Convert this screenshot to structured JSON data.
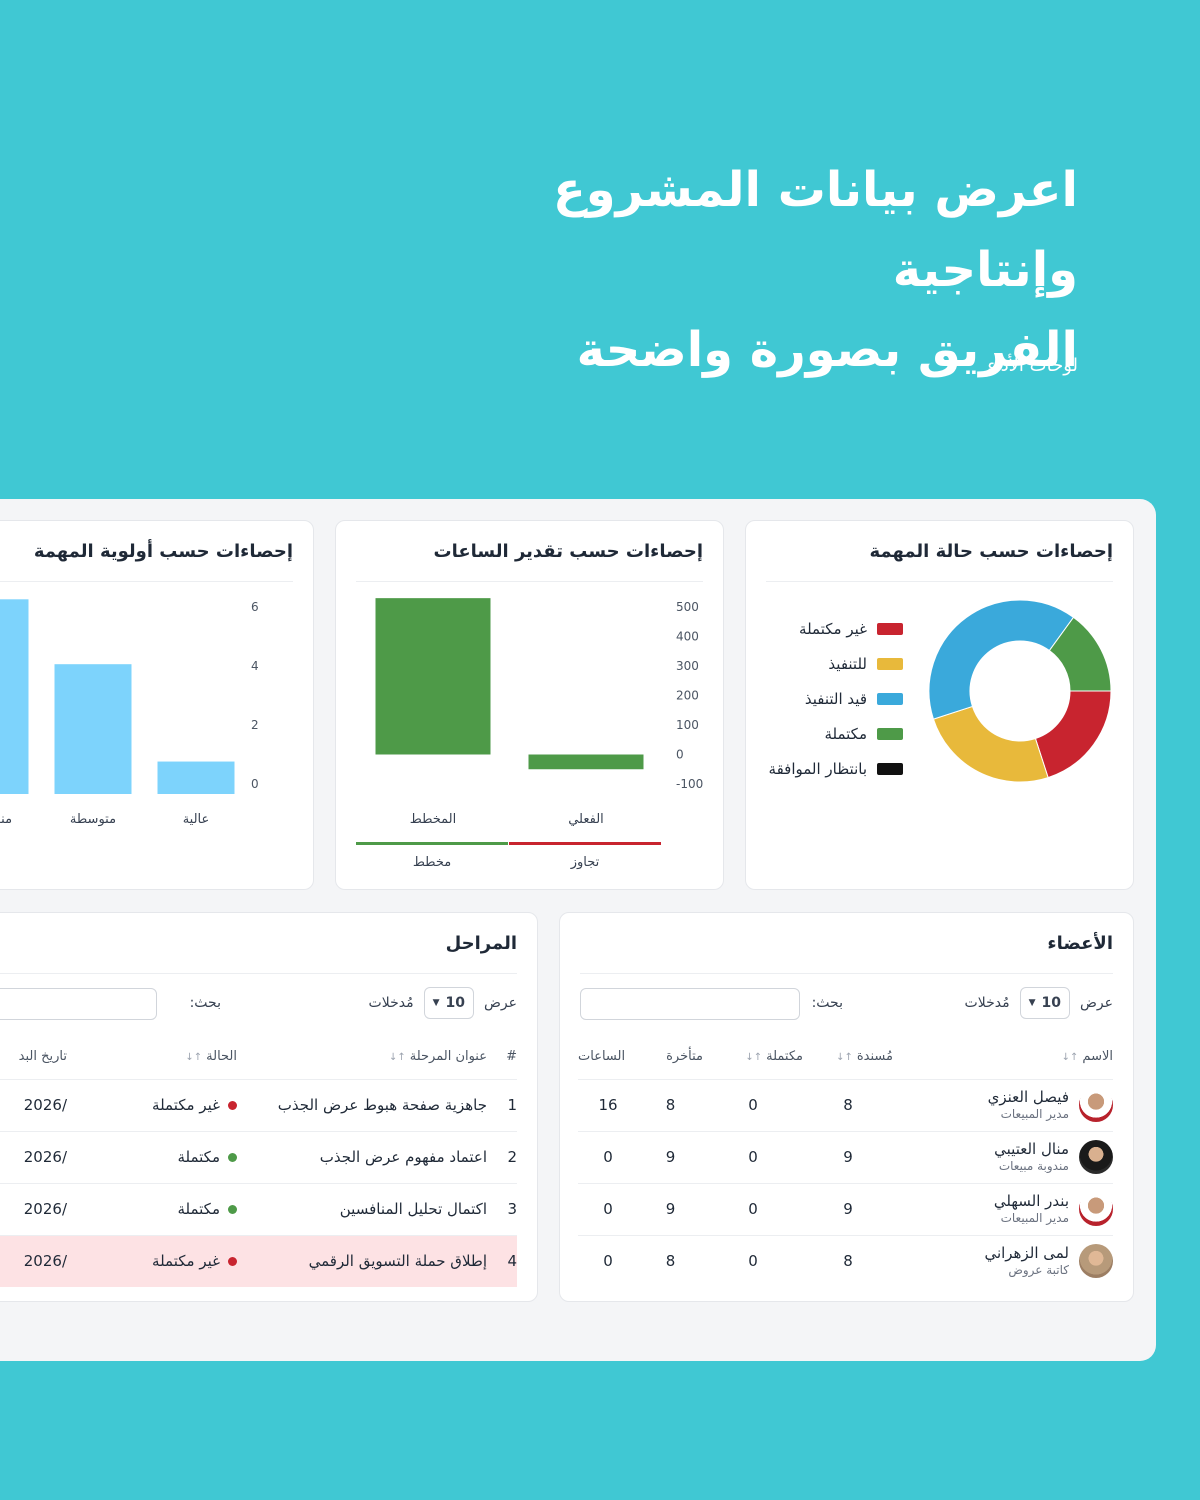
{
  "hero": {
    "title_line1": "اعرض بيانات المشروع وإنتاجية",
    "title_line2": "الفريق بصورة واضحة",
    "subtitle": "لوحات الأداء"
  },
  "status_card": {
    "title": "إحصاءات حسب حالة المهمة",
    "legend": [
      {
        "label": "غير مكتملة",
        "color": "#c8242f"
      },
      {
        "label": "للتنفيذ",
        "color": "#e8b93b"
      },
      {
        "label": "قيد التنفيذ",
        "color": "#3aa9db"
      },
      {
        "label": "مكتملة",
        "color": "#4e9a48"
      },
      {
        "label": "بانتظار الموافقة",
        "color": "#111111"
      }
    ]
  },
  "hours_card": {
    "title": "إحصاءات حسب تقدير الساعات",
    "legend": [
      {
        "label": "مخطط",
        "color": "#4e9a48"
      },
      {
        "label": "تجاوز",
        "color": "#c8242f"
      }
    ]
  },
  "priority_card": {
    "title": "إحصاءات حسب أولوية المهمة"
  },
  "chart_data": [
    {
      "type": "pie",
      "title": "إحصاءات حسب حالة المهمة",
      "categories": [
        "غير مكتملة",
        "للتنفيذ",
        "قيد التنفيذ",
        "مكتملة",
        "بانتظار الموافقة"
      ],
      "values": [
        20,
        25,
        40,
        15,
        0
      ],
      "colors": [
        "#c8242f",
        "#e8b93b",
        "#3aa9db",
        "#4e9a48",
        "#111111"
      ]
    },
    {
      "type": "bar",
      "title": "إحصاءات حسب تقدير الساعات",
      "categories": [
        "الفعلي",
        "المخطط"
      ],
      "values": [
        -50,
        530
      ],
      "ylim": [
        -100,
        500
      ],
      "yticks": [
        500,
        400,
        300,
        200,
        100,
        0,
        -100
      ],
      "color": "#4e9a48"
    },
    {
      "type": "bar",
      "title": "إحصاءات حسب أولوية المهمة",
      "categories": [
        "عالية",
        "متوسطة",
        "منخفضة"
      ],
      "values": [
        1.1,
        4.4,
        6.6
      ],
      "ylim": [
        0,
        7
      ],
      "yticks": [
        6,
        4,
        2,
        0
      ],
      "color": "#7dd3fc"
    }
  ],
  "members": {
    "title": "الأعضاء",
    "show_label": "عرض",
    "entries_value": "10",
    "entries_label": "مُدخلات",
    "search_label": "بحث:",
    "columns": [
      "الاسم",
      "مُسندة",
      "مكتملة",
      "متأخرة",
      "الساعات"
    ],
    "rows": [
      {
        "name": "فيصل العنزي",
        "role": "مدير المبيعات",
        "assigned": "8",
        "completed": "0",
        "late": "8",
        "hours": "16"
      },
      {
        "name": "منال العتيبي",
        "role": "مندوبة مبيعات",
        "assigned": "9",
        "completed": "0",
        "late": "9",
        "hours": "0"
      },
      {
        "name": "بندر السهلي",
        "role": "مدير المبيعات",
        "assigned": "9",
        "completed": "0",
        "late": "9",
        "hours": "0"
      },
      {
        "name": "لمى الزهراني",
        "role": "كاتبة عروض",
        "assigned": "8",
        "completed": "0",
        "late": "8",
        "hours": "0"
      }
    ]
  },
  "phases": {
    "title": "المراحل",
    "show_label": "عرض",
    "entries_value": "10",
    "entries_label": "مُدخلات",
    "search_label": "بحث:",
    "columns": [
      "#",
      "عنوان المرحلة",
      "الحالة",
      "تاريخ البد"
    ],
    "rows": [
      {
        "num": "1",
        "title": "جاهزية صفحة هبوط عرض الجذب",
        "status": "غير مكتملة",
        "status_color": "#c8242f",
        "date": "/2026"
      },
      {
        "num": "2",
        "title": "اعتماد مفهوم عرض الجذب",
        "status": "مكتملة",
        "status_color": "#4e9a48",
        "date": "/2026"
      },
      {
        "num": "3",
        "title": "اكتمال تحليل المنافسين",
        "status": "مكتملة",
        "status_color": "#4e9a48",
        "date": "/2026"
      },
      {
        "num": "4",
        "title": "إطلاق حملة التسويق الرقمي",
        "status": "غير مكتملة",
        "status_color": "#c8242f",
        "date": "/2026"
      }
    ]
  }
}
